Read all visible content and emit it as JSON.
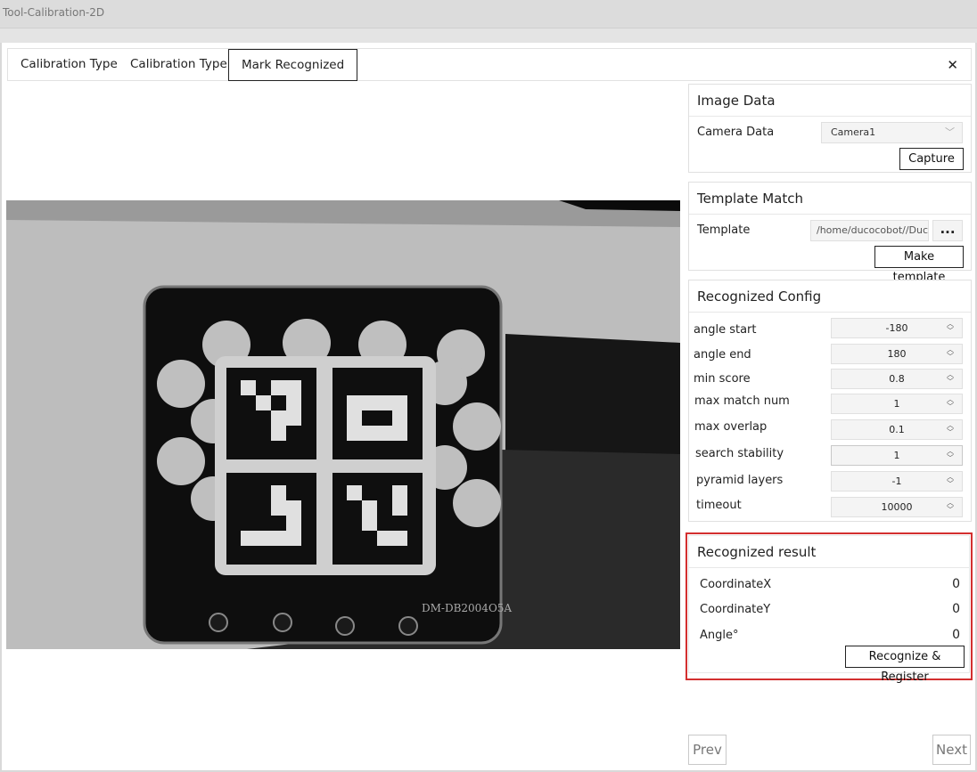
{
  "window": {
    "title": "Tool-Calibration-2D"
  },
  "tabs": [
    {
      "label": "Calibration Type"
    },
    {
      "label": "Calibration Type"
    },
    {
      "label": "Mark Recognized"
    }
  ],
  "close_label": "✕",
  "image_data": {
    "title": "Image Data",
    "camera_label": "Camera Data",
    "camera_value": "Camera1",
    "capture_label": "Capture"
  },
  "template_match": {
    "title": "Template Match",
    "template_label": "Template",
    "template_path": "/home/ducocobot//Duc",
    "browse_label": "...",
    "make_template_label": "Make template"
  },
  "recognized_config": {
    "title": "Recognized Config",
    "params": [
      {
        "label": "angle start",
        "value": "-180"
      },
      {
        "label": "angle end",
        "value": "180"
      },
      {
        "label": "min score",
        "value": "0.8"
      },
      {
        "label": "max match num",
        "value": "1"
      },
      {
        "label": "max overlap",
        "value": "0.1"
      },
      {
        "label": "search stability",
        "value": "1"
      },
      {
        "label": "pyramid layers",
        "value": "-1"
      },
      {
        "label": "timeout",
        "value": "10000"
      }
    ]
  },
  "recognized_result": {
    "title": "Recognized result",
    "rows": [
      {
        "label": "CoordinateX",
        "value": "0"
      },
      {
        "label": "CoordinateY",
        "value": "0"
      },
      {
        "label": "Angle°",
        "value": "0"
      }
    ],
    "button_label": "Recognize & Register"
  },
  "calibration_board": {
    "marking": "DM-DB2004O5A"
  },
  "nav": {
    "prev_label": "Prev",
    "next_label": "Next"
  },
  "colors": {
    "highlight": "#d32f2f"
  }
}
